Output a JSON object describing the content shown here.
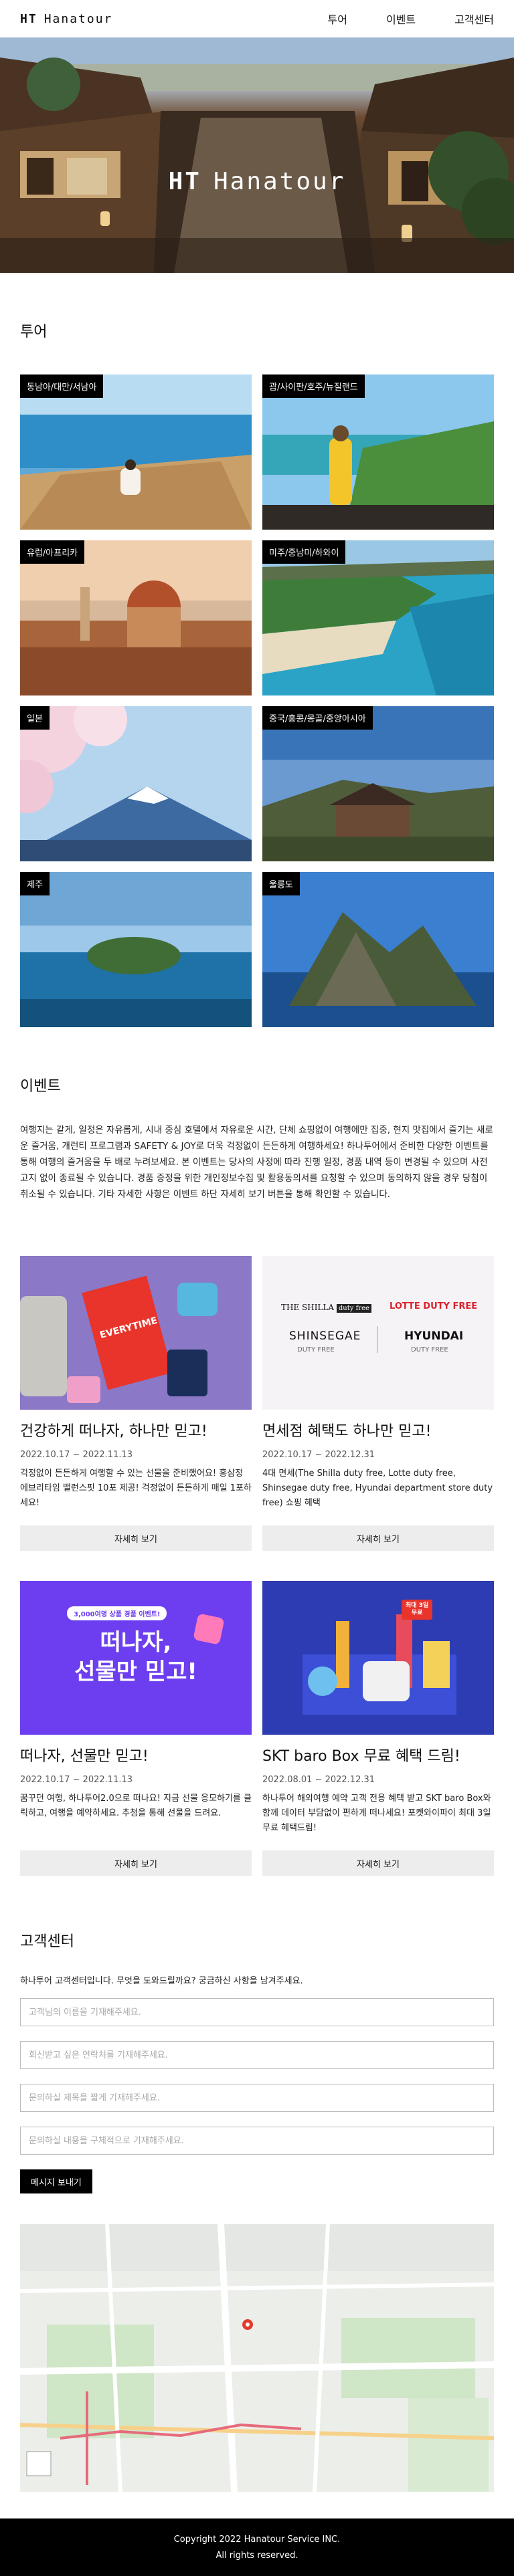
{
  "header": {
    "logo_mark": "HT",
    "logo_text": "Hanatour",
    "nav": [
      {
        "label": "투어"
      },
      {
        "label": "이벤트"
      },
      {
        "label": "고객센터"
      }
    ]
  },
  "hero": {
    "title_mark": "HT",
    "title_text": "Hanatour"
  },
  "tour": {
    "heading": "투어",
    "cards": [
      {
        "label": "동남아/대만/서남아"
      },
      {
        "label": "괌/사이판/호주/뉴질랜드"
      },
      {
        "label": "유럽/아프리카"
      },
      {
        "label": "미주/중남미/하와이"
      },
      {
        "label": "일본"
      },
      {
        "label": "중국/홍콩/몽골/중앙아시아"
      },
      {
        "label": "제주"
      },
      {
        "label": "울릉도"
      }
    ]
  },
  "events": {
    "heading": "이벤트",
    "intro": "여행지는 같게, 일정은 자유롭게, 시내 중심 호텔에서 자유로운 시간, 단체 쇼핑없이 여행에만 집중, 현지 맛집에서 즐기는 새로운 즐거움, 개런티 프로그램과 SAFETY & JOY로 더욱 걱정없이 든든하게 여행하세요! 하나투어에서 준비한 다양한 이벤트를 통해 여행의 즐거움을 두 배로 누려보세요. 본 이벤트는 당사의 사정에 따라 진행 일정, 경품 내역 등이 변경될 수 있으며 사전 고지 없이 종료될 수 있습니다. 경품 증정을 위한 개인정보수집 및 활용동의서를 요청할 수 있으며 동의하지 않을 경우 당첨이 취소될 수 있습니다. 기타 자세한 사항은 이벤트 하단 자세히 보기 버튼을 통해 확인할 수 있습니다.",
    "button_label": "자세히 보기",
    "items": [
      {
        "title": "건강하게 떠나자, 하나만 믿고!",
        "date": "2022.10.17 ~ 2022.11.13",
        "desc": "걱정없이 든든하게 여행할 수 있는 선물을 준비했어요! 홍삼정 에브리타임 밸런스핏 10포 제공! 걱정없이 든든하게 매일 1포하세요!",
        "img_text_1": "EVERYTIME"
      },
      {
        "title": "면세점 혜택도 하나만 믿고!",
        "date": "2022.10.17 ~ 2022.12.31",
        "desc": "4대 면세(The Shilla duty free, Lotte duty free, Shinsegae duty free, Hyundai department store duty free) 쇼핑 혜택",
        "img_text_1": "THE SHILLA",
        "img_text_2": "duty free",
        "img_text_3": "LOTTE DUTY FREE",
        "img_text_4": "SHINSEGAE",
        "img_text_5": "DUTY FREE",
        "img_text_6": "HYUNDAI",
        "img_text_7": "DUTY FREE"
      },
      {
        "title": "떠나자, 선물만 믿고!",
        "date": "2022.10.17 ~ 2022.11.13",
        "desc": "꿈꾸던 여행, 하나투어2.0으로 떠나요! 지금 선물 응모하기를 클릭하고, 여행을 예약하세요. 추첨을 통해 선물을 드려요.",
        "img_text_1": "3,000여명 상품 경품 이벤트!",
        "img_text_2": "떠나자,",
        "img_text_3": "선물만 믿고!"
      },
      {
        "title": "SKT baro Box 무료 혜택 드림!",
        "date": "2022.08.01 ~ 2022.12.31",
        "desc": "하나투어 해외여행 예약 고객 전용 혜택 받고 SKT baro Box와 함께 데이터 부담없이 편하게 떠나세요! 포켓와이파이 최대 3일 무료 혜택드림!",
        "img_text_1": "최대 3일",
        "img_text_2": "무료"
      }
    ]
  },
  "contact": {
    "heading": "고객센터",
    "sub": "하나투어 고객센터입니다. 무엇을 도와드릴까요? 궁금하신 사항을 남겨주세요.",
    "fields": [
      {
        "placeholder": "고객님의 이름을 기재해주세요."
      },
      {
        "placeholder": "회신받고 싶은 연락처를 기재해주세요."
      },
      {
        "placeholder": "문의하실 제목을 짧게 기재해주세요."
      },
      {
        "placeholder": "문의하실 내용을 구체적으로 기재해주세요."
      }
    ],
    "send_label": "메시지 보내기"
  },
  "footer": {
    "line1": "Copyright 2022 Hanatour Service INC.",
    "line2": "All rights reserved."
  },
  "colors": {
    "footer_bg": "#000000",
    "button_bg": "#ededed",
    "tag_bg": "#000000"
  }
}
